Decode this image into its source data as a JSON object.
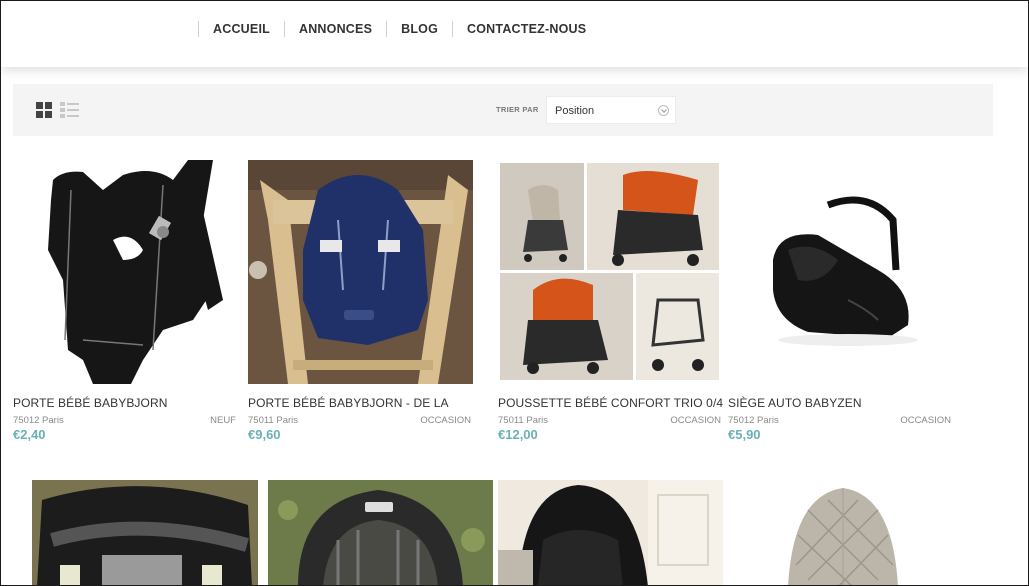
{
  "nav": {
    "items": [
      {
        "label": "ACCUEIL"
      },
      {
        "label": "ANNONCES"
      },
      {
        "label": "BLOG"
      },
      {
        "label": "CONTACTEZ-NOUS"
      }
    ]
  },
  "toolbar": {
    "sort_label": "TRIER PAR",
    "sort_value": "Position",
    "view_modes": [
      "grid-icon",
      "list-icon"
    ]
  },
  "products": [
    {
      "title": "PORTE BÉBÉ BABYBJORN",
      "location": "75012 Paris",
      "condition": "NEUF",
      "price": "€2,40",
      "image": "baby-carrier-black"
    },
    {
      "title": "PORTE BÉBÉ BABYBJORN - DE LA",
      "location": "75011 Paris",
      "condition": "OCCASION",
      "price": "€9,60",
      "image": "baby-carrier-navy-on-chair"
    },
    {
      "title": "POUSSETTE BÉBÉ CONFORT TRIO 0/4",
      "location": "75011 Paris",
      "condition": "OCCASION",
      "price": "€12,00",
      "image": "stroller-collage"
    },
    {
      "title": "SIÈGE AUTO BABYZEN",
      "location": "75012 Paris",
      "condition": "OCCASION",
      "price": "€5,90",
      "image": "car-seat-black"
    }
  ],
  "products_row2": [
    {
      "image": "car-seat-grey-closeup"
    },
    {
      "image": "chicco-car-seat"
    },
    {
      "image": "black-car-seat-indoor"
    },
    {
      "image": "bouncer-seat-grey"
    }
  ],
  "colors": {
    "price": "#6ab0b8",
    "toolbar_bg": "#f4f4f4",
    "nav_text": "#333333"
  }
}
